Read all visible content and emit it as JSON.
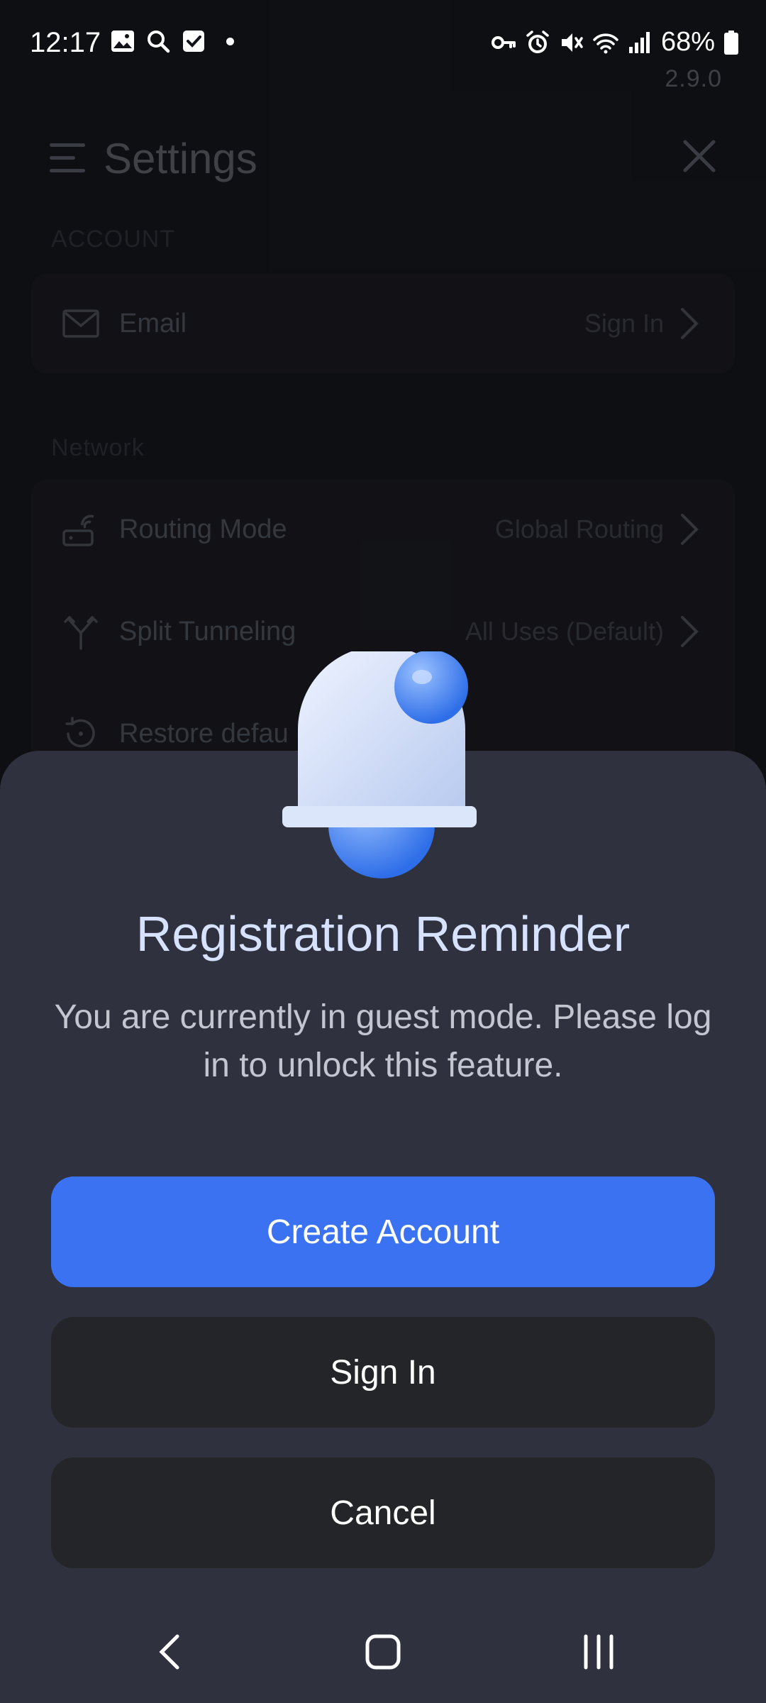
{
  "status_bar": {
    "time": "12:17",
    "battery": "68%"
  },
  "settings": {
    "version": "2.9.0",
    "title": "Settings",
    "sections": [
      {
        "label": "ACCOUNT",
        "rows": [
          {
            "label": "Email",
            "value": "Sign In",
            "icon": "mail-icon"
          }
        ]
      },
      {
        "label": "Network",
        "rows": [
          {
            "label": "Routing Mode",
            "value": "Global Routing",
            "icon": "router-icon"
          },
          {
            "label": "Split Tunneling",
            "value": "All Uses (Default)",
            "icon": "split-icon"
          },
          {
            "label": "Restore defau",
            "value": "",
            "icon": "restore-icon"
          }
        ]
      }
    ]
  },
  "dialog": {
    "title": "Registration Reminder",
    "message": "You are currently in guest mode. Please log in to unlock this feature.",
    "primary_button": "Create Account",
    "signin_button": "Sign In",
    "cancel_button": "Cancel"
  },
  "colors": {
    "accent": "#3a72f2",
    "sheet_bg": "#2f313e",
    "title_color": "#d6e2ff"
  }
}
